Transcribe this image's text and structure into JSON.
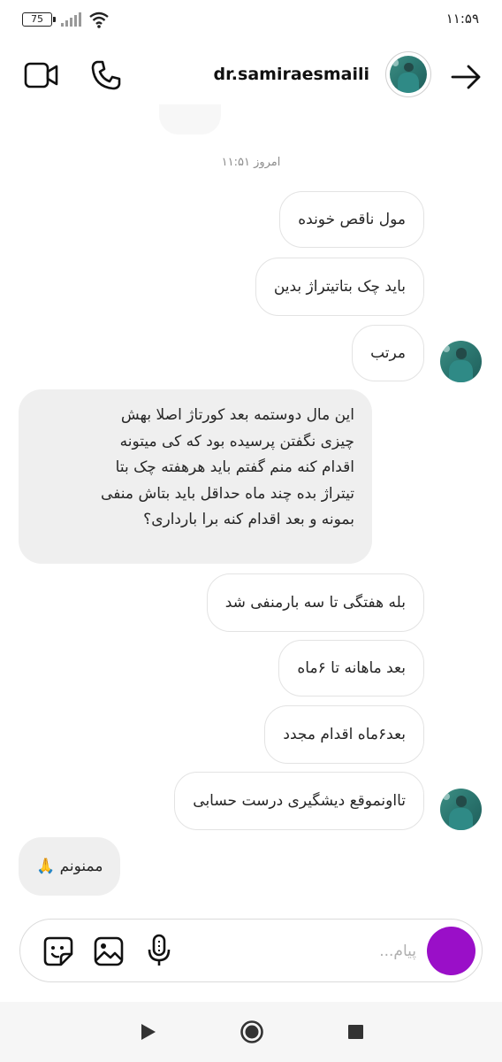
{
  "status_bar": {
    "battery": "75",
    "time": "۱۱:۵۹"
  },
  "header": {
    "username": "dr.samiraesmaili"
  },
  "timestamp": "امروز ۱۱:۵۱",
  "messages": [
    {
      "text": "مول ناقص خونده"
    },
    {
      "text": "باید چک بتاتیتراژ بدین"
    },
    {
      "text": "مرتب"
    },
    {
      "lines": [
        "این مال دوستمه بعد کورتاژ اصلا بهش",
        "چیزی نگفتن پرسیده بود که کی میتونه",
        "اقدام کنه منم گفتم باید هرهفته چک بتا",
        "تیتراژ بده چند ماه  حداقل باید بتاش منفی",
        "بمونه و بعد اقدام کنه برا بارداری؟"
      ]
    },
    {
      "text": "بله هفتگی تا سه بارمنفی شد"
    },
    {
      "text": "بعد ماهانه تا ۶ماه"
    },
    {
      "text": "بعد۶ماه اقدام مجدد"
    },
    {
      "text": "تااونموقع دیشگیری درست حسابی"
    },
    {
      "text": "ممنونم 🙏"
    }
  ],
  "composer": {
    "placeholder": "پیام..."
  },
  "colors": {
    "accent": "#9a0fc8",
    "received_bubble": "#efefef",
    "sent_border": "#e3e3e3"
  },
  "icons": [
    "video-call-icon",
    "phone-icon",
    "back-arrow-icon",
    "sticker-icon",
    "gallery-icon",
    "microphone-icon",
    "camera-icon"
  ]
}
